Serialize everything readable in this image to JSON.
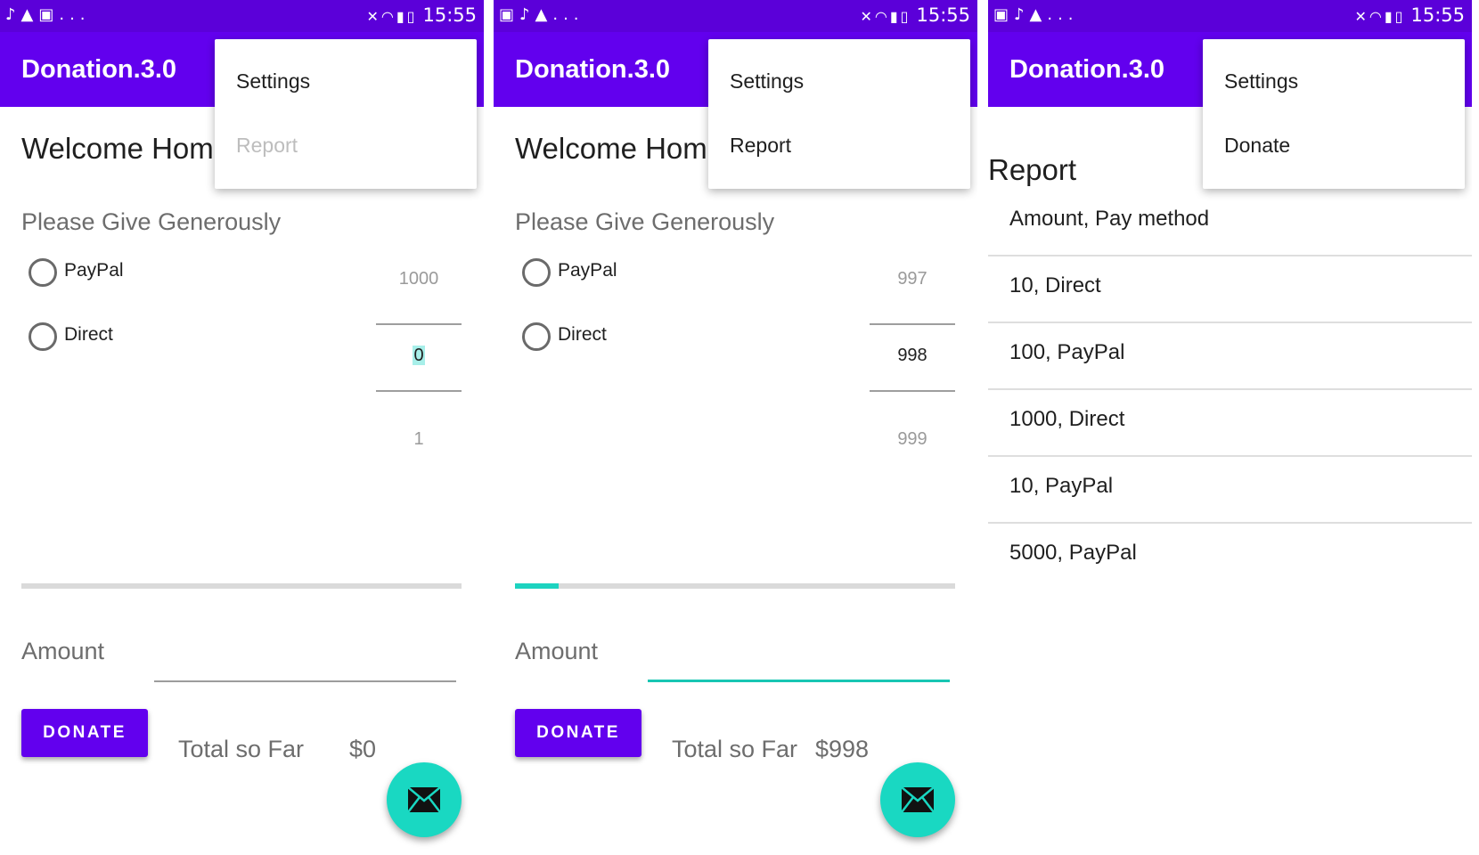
{
  "status_bar": {
    "time": "15:55",
    "ellipsis": "...",
    "panels_left_icons": [
      [
        "tiktok-icon",
        "warning-icon",
        "image-icon"
      ],
      [
        "image-icon",
        "tiktok-icon",
        "warning-icon"
      ],
      [
        "image-icon",
        "tiktok-icon",
        "warning-icon"
      ]
    ],
    "right_icons": [
      "mute-icon",
      "wifi-icon",
      "signal-icon",
      "battery-icon"
    ]
  },
  "app": {
    "title": "Donation.3.0"
  },
  "panels": [
    {
      "welcome": "Welcome Homer",
      "subtitle": "Please Give Generously",
      "radio_options": [
        "PayPal",
        "Direct"
      ],
      "picker": {
        "prev": "1000",
        "current": "0",
        "next": "1"
      },
      "progress_fraction": 0,
      "amount_label": "Amount",
      "amount_value": "",
      "donate_label": "DONATE",
      "total_label": "Total so Far",
      "total_value": "$0",
      "menu": {
        "items": [
          "Settings",
          "Report"
        ],
        "disabled": [
          "Report"
        ]
      }
    },
    {
      "welcome": "Welcome Homer",
      "subtitle": "Please Give Generously",
      "radio_options": [
        "PayPal",
        "Direct"
      ],
      "picker": {
        "prev": "997",
        "current": "998",
        "next": "999"
      },
      "progress_fraction": 0.1,
      "amount_label": "Amount",
      "amount_value": "",
      "donate_label": "DONATE",
      "total_label": "Total so Far",
      "total_value": "$998",
      "menu": {
        "items": [
          "Settings",
          "Report"
        ],
        "disabled": []
      }
    },
    {
      "report_title": "Report",
      "report_rows": [
        "Amount, Pay method",
        "10, Direct",
        "100, PayPal",
        "1000, Direct",
        "10, PayPal",
        "5000, PayPal"
      ],
      "menu": {
        "items": [
          "Settings",
          "Donate"
        ],
        "disabled": []
      }
    }
  ],
  "colors": {
    "status_bar": "#5b00d9",
    "app_bar": "#6200ee",
    "accent": "#19d8c2",
    "donate_button": "#6200ee"
  },
  "fab_icon": "mail-icon"
}
